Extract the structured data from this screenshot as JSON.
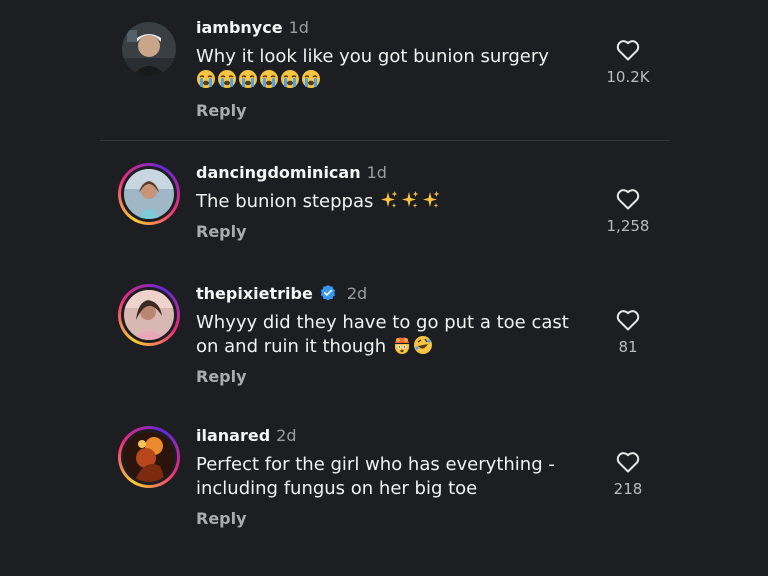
{
  "comments": [
    {
      "username": "iambnyce",
      "time": "1d",
      "text": "Why it look like you got bunion surgery",
      "emoji_icons": [
        "loudly-crying-face",
        "loudly-crying-face",
        "loudly-crying-face",
        "loudly-crying-face",
        "loudly-crying-face",
        "loudly-crying-face"
      ],
      "reply_label": "Reply",
      "likes": "10.2K",
      "has_story_ring": false,
      "verified": false
    },
    {
      "username": "dancingdominican",
      "time": "1d",
      "text": "The bunion steppas",
      "emoji_icons": [
        "sparkles",
        "sparkles",
        "sparkles"
      ],
      "reply_label": "Reply",
      "likes": "1,258",
      "has_story_ring": true,
      "verified": false
    },
    {
      "username": "thepixietribe",
      "time": "2d",
      "text": "Whyyy did they have to go put a toe cast on and ruin it though",
      "emoji_icons": [
        "exploding-head",
        "rolling-on-floor-laughing"
      ],
      "reply_label": "Reply",
      "likes": "81",
      "has_story_ring": true,
      "verified": true
    },
    {
      "username": "ilanared",
      "time": "2d",
      "text": "Perfect for the girl who has everything - including fungus on her big toe",
      "emoji_icons": [],
      "reply_label": "Reply",
      "likes": "218",
      "has_story_ring": true,
      "verified": false
    }
  ],
  "colors": {
    "background": "#1c1e22",
    "verified_badge": "#3897f0",
    "secondary_text": "#9a9ca1"
  }
}
